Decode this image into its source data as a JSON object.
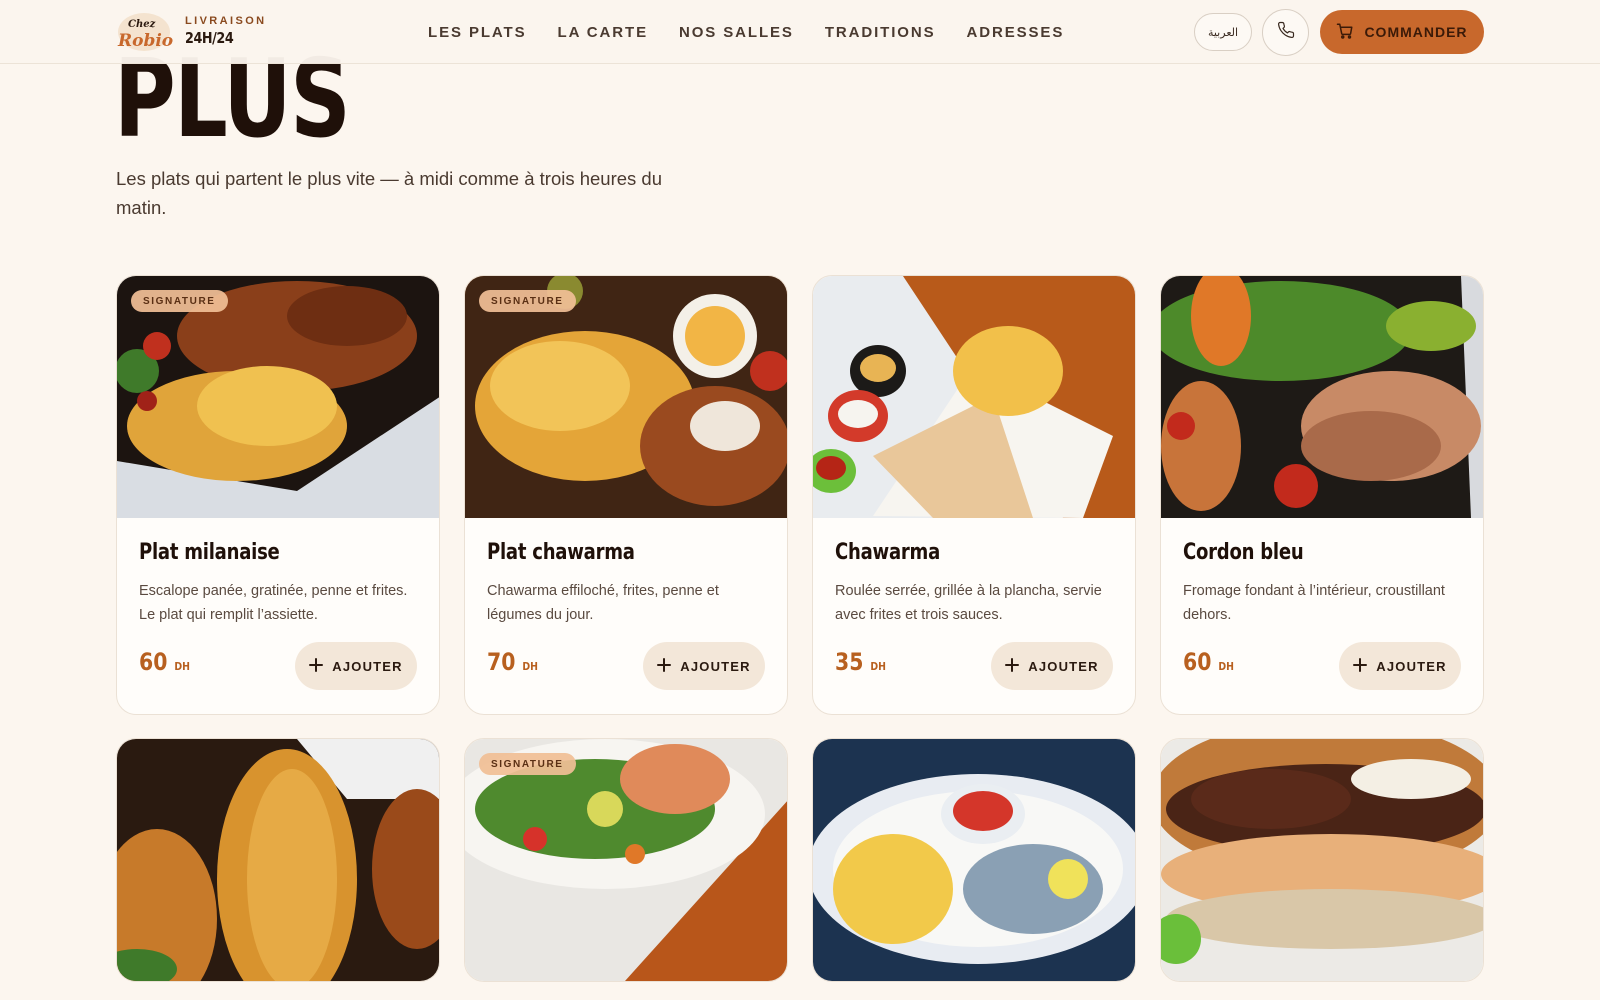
{
  "header": {
    "logo_alt": "Chez Robio",
    "tagline_top": "LIVRAISON",
    "tagline_bottom": "24H/24",
    "nav": [
      "LES PLATS",
      "LA CARTE",
      "NOS SALLES",
      "TRADITIONS",
      "ADRESSES"
    ],
    "lang_label": "العربية",
    "order_label": "COMMANDER",
    "accent": "#c8682c"
  },
  "hero": {
    "title": "PLUS",
    "subtitle": "Les plats qui partent le plus vite — à midi comme à trois heures du matin."
  },
  "cards": [
    {
      "title": "Plat milanaise",
      "desc": "Escalope panée, gratinée, penne et frites. Le plat qui remplit l’assiette.",
      "price": "60",
      "currency": "DH",
      "badge": "SIGNATURE",
      "add": "AJOUTER"
    },
    {
      "title": "Plat chawarma",
      "desc": "Chawarma effiloché, frites, penne et légumes du jour.",
      "price": "70",
      "currency": "DH",
      "badge": "SIGNATURE",
      "add": "AJOUTER"
    },
    {
      "title": "Chawarma",
      "desc": "Roulée serrée, grillée à la plancha, servie avec frites et trois sauces.",
      "price": "35",
      "currency": "DH",
      "badge": "",
      "add": "AJOUTER"
    },
    {
      "title": "Cordon bleu",
      "desc": "Fromage fondant à l’intérieur, croustillant dehors.",
      "price": "60",
      "currency": "DH",
      "badge": "",
      "add": "AJOUTER"
    },
    {
      "badge": ""
    },
    {
      "badge": "SIGNATURE"
    },
    {
      "badge": ""
    },
    {
      "badge": ""
    }
  ]
}
